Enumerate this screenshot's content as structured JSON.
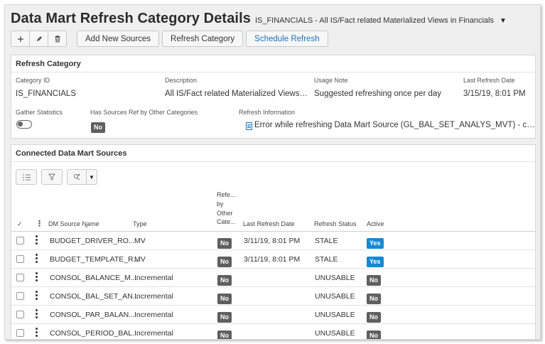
{
  "header": {
    "title": "Data Mart Refresh Category Details",
    "context": "IS_FINANCIALS - All IS/Fact related Materialized Views in Financials"
  },
  "toolbar": {
    "icons": [
      "plus-icon",
      "pencil-icon",
      "trash-icon"
    ],
    "add_sources_label": "Add New Sources",
    "refresh_label": "Refresh Category",
    "schedule_label": "Schedule Refresh"
  },
  "refresh_category": {
    "title": "Refresh Category",
    "category_id_label": "Category ID",
    "category_id": "IS_FINANCIALS",
    "description_label": "Description",
    "description": "All IS/Fact related Materialized Views in Financials",
    "usage_note_label": "Usage Note",
    "usage_note": "Suggested refreshing once per day",
    "last_refresh_label": "Last Refresh Date",
    "last_refresh": "3/15/19, 8:01 PM",
    "gather_stats_label": "Gather Statistics",
    "gather_stats_on": false,
    "has_sources_label": "Has Sources Ref by Other Categories",
    "has_sources_value": "No",
    "refresh_info_label": "Refresh Information",
    "refresh_info": "Error while refreshing Data Mart Source (GL_BAL_SET_ANALYS_MVT) - cannot ..."
  },
  "sources": {
    "title": "Connected Data Mart Sources",
    "columns": {
      "check": "✓",
      "name": "DM Source Name",
      "type": "Type",
      "ref": [
        "Refe...",
        "by",
        "Other",
        "Cate..."
      ],
      "last_refresh": "Last Refresh Date",
      "status": "Refresh Status",
      "active": "Active"
    },
    "rows": [
      {
        "name": "BUDGET_DRIVER_RO...",
        "type": "MV",
        "ref": "No",
        "last_refresh": "3/11/19, 8:01 PM",
        "status": "STALE",
        "active": "Yes"
      },
      {
        "name": "BUDGET_TEMPLATE_R...",
        "type": "MV",
        "ref": "No",
        "last_refresh": "3/11/19, 8:01 PM",
        "status": "STALE",
        "active": "Yes"
      },
      {
        "name": "CONSOL_BALANCE_M...",
        "type": "Incremental",
        "ref": "No",
        "last_refresh": "",
        "status": "UNUSABLE",
        "active": "No"
      },
      {
        "name": "CONSOL_BAL_SET_AN...",
        "type": "Incremental",
        "ref": "No",
        "last_refresh": "",
        "status": "UNUSABLE",
        "active": "No"
      },
      {
        "name": "CONSOL_PAR_BALAN...",
        "type": "Incremental",
        "ref": "No",
        "last_refresh": "",
        "status": "UNUSABLE",
        "active": "No"
      },
      {
        "name": "CONSOL_PERIOD_BAL...",
        "type": "Incremental",
        "ref": "No",
        "last_refresh": "",
        "status": "UNUSABLE",
        "active": "No"
      }
    ]
  },
  "colors": {
    "accent": "#1a73b8",
    "badge_yes": "#1589d2",
    "badge_no": "#5f5f5f"
  }
}
